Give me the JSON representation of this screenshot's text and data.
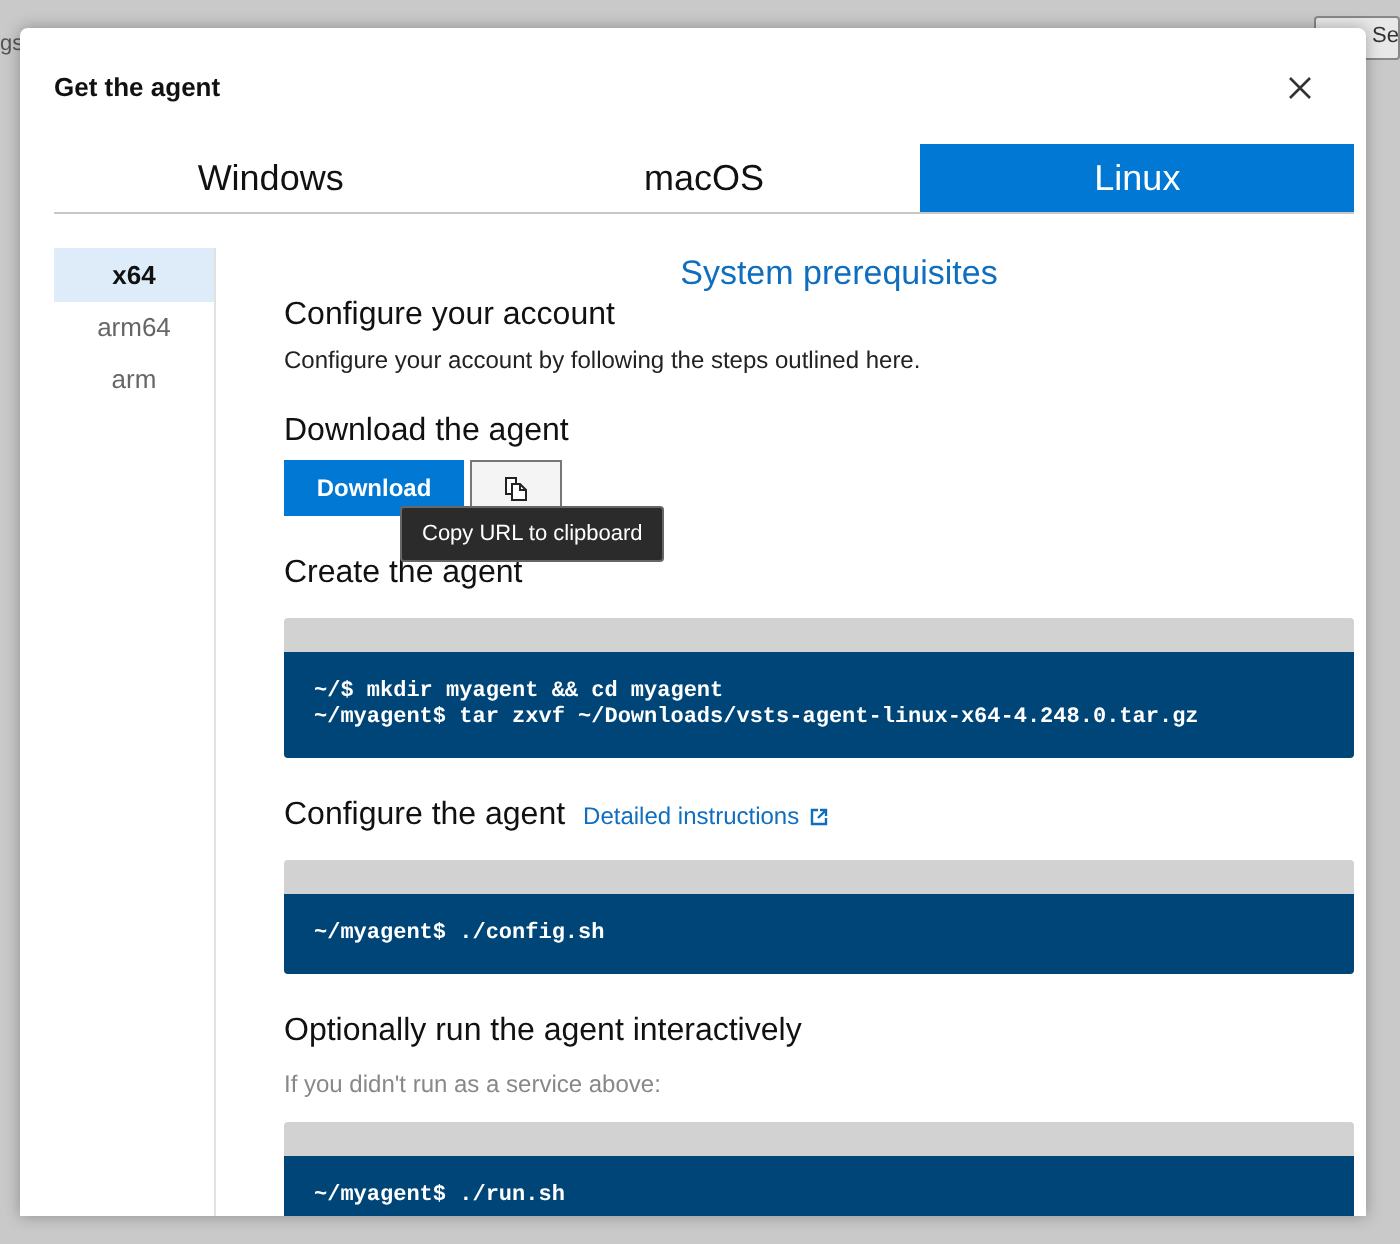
{
  "background": {
    "left_text": "gs",
    "right_button": "Se"
  },
  "dialog": {
    "title": "Get the agent",
    "tabs": [
      {
        "label": "Windows",
        "selected": false
      },
      {
        "label": "macOS",
        "selected": false
      },
      {
        "label": "Linux",
        "selected": true
      }
    ],
    "architectures": [
      {
        "label": "x64",
        "selected": true
      },
      {
        "label": "arm64",
        "selected": false
      },
      {
        "label": "arm",
        "selected": false
      }
    ],
    "prerequisites_link": "System prerequisites",
    "sections": [
      {
        "kind": "text",
        "heading": "Configure your account",
        "description": "Configure your account by following the steps outlined here."
      },
      {
        "kind": "download",
        "heading": "Download the agent",
        "button": "Download",
        "tooltip": "Copy URL to clipboard"
      },
      {
        "kind": "code",
        "heading": "Create the agent",
        "lines": [
          "~/$ mkdir myagent && cd myagent",
          "~/myagent$ tar zxvf ~/Downloads/vsts-agent-linux-x64-4.248.0.tar.gz"
        ]
      },
      {
        "kind": "code",
        "heading": "Configure the agent",
        "link": "Detailed instructions",
        "lines": [
          "~/myagent$ ./config.sh"
        ]
      },
      {
        "kind": "code",
        "heading": "Optionally run the agent interactively",
        "note": "If you didn't run as a service above:",
        "lines": [
          "~/myagent$ ./run.sh"
        ]
      }
    ]
  }
}
